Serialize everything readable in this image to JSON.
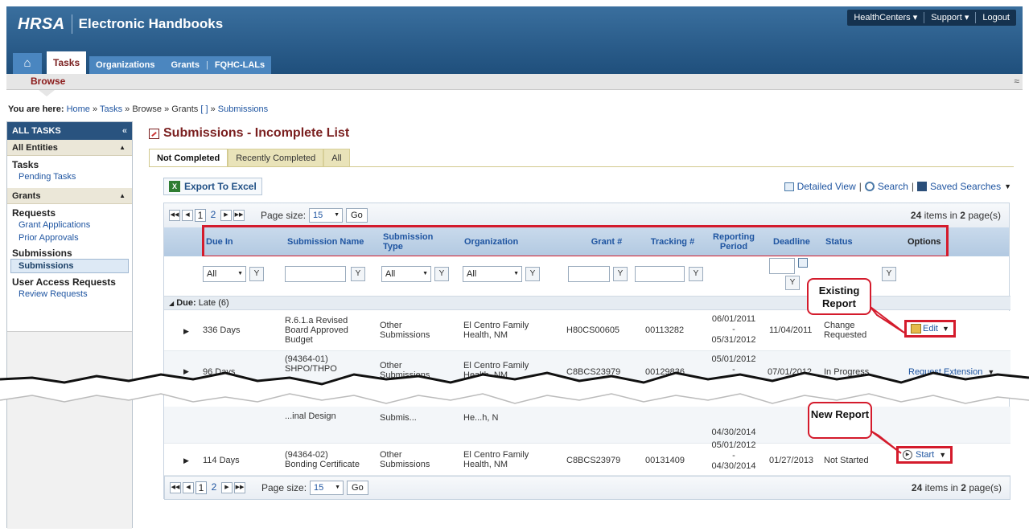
{
  "app": {
    "logo": "HRSA",
    "title": "Electronic Handbooks"
  },
  "top_links": [
    "HealthCenters ▾",
    "Support ▾",
    "Logout"
  ],
  "nav": {
    "home": "⌂",
    "tabs": [
      "Tasks",
      "Organizations",
      "Grants",
      "FQHC-LALs"
    ],
    "sep": "|"
  },
  "subnav": {
    "item": "Browse",
    "collapse": "≈"
  },
  "breadcrumb": {
    "prefix": "You are here:",
    "home": "Home",
    "tasks": "Tasks",
    "browse": "Browse",
    "grants": "Grants",
    "grants_suffix": "[  ]",
    "submissions": "Submissions",
    "sep": "»"
  },
  "sidebar": {
    "header": "ALL TASKS",
    "collapse": "«",
    "groups": [
      {
        "label": "All Entities",
        "sections": [
          {
            "title": "Tasks",
            "links": [
              "Pending Tasks"
            ]
          }
        ]
      },
      {
        "label": "Grants",
        "sections": [
          {
            "title": "Requests",
            "links": [
              "Grant Applications",
              "Prior Approvals"
            ]
          },
          {
            "title": "Submissions",
            "links": [
              "Submissions"
            ]
          },
          {
            "title": "User Access Requests",
            "links": [
              "Review Requests"
            ]
          }
        ]
      }
    ]
  },
  "page": {
    "title": "Submissions - Incomplete List"
  },
  "tabs": [
    "Not Completed",
    "Recently Completed",
    "All"
  ],
  "toolbar": {
    "export": "Export To Excel",
    "detailed_view": "Detailed View",
    "search": "Search",
    "saved_searches": "Saved Searches",
    "sep": "|"
  },
  "pager": {
    "pages": [
      "1",
      "2"
    ],
    "page_size_label": "Page size:",
    "page_size": "15",
    "go": "Go",
    "total": "24",
    "info_mid": "items in",
    "pages_count": "2",
    "info_end": "page(s)"
  },
  "columns": [
    "Due In",
    "Submission Name",
    "Submission Type",
    "Organization",
    "Grant #",
    "Tracking #",
    "Reporting Period",
    "Deadline",
    "Status",
    "Options"
  ],
  "filters": {
    "all": "All",
    "filter_icon": "Y"
  },
  "group": {
    "label": "Due:",
    "value": "Late (6)"
  },
  "rows": [
    {
      "due_in": "336 Days",
      "name": "R.6.1.a Revised Board Approved Budget",
      "type": "Other Submissions",
      "org": "El Centro Family Health, NM",
      "grant": "H80CS00605",
      "tracking": "00113282",
      "period_start": "06/01/2011",
      "period_dash": "-",
      "period_end": "05/31/2012",
      "deadline": "11/04/2011",
      "status": "Change Requested",
      "option": "Edit"
    },
    {
      "due_in": "96 Days",
      "name": "(94364-01) SHPO/THPO",
      "type": "Other Submissions",
      "org": "El Centro Family Health, NM",
      "grant": "C8BCS23979",
      "tracking": "00129836",
      "period_start": "05/01/2012",
      "period_dash": "-",
      "period_end": "",
      "deadline": "07/01/2012",
      "status": "In Progress",
      "option": "Request Extension"
    },
    {
      "due_in": "",
      "name": "...inal Design",
      "type": "Submis...",
      "org": "He...h, N",
      "grant": "",
      "tracking": "",
      "period_start": "",
      "period_dash": "",
      "period_end": "04/30/2014",
      "deadline": "",
      "status": "",
      "option": ""
    },
    {
      "due_in": "114 Days",
      "name": "(94364-02) Bonding Certificate",
      "type": "Other Submissions",
      "org": "El Centro Family Health, NM",
      "grant": "C8BCS23979",
      "tracking": "00131409",
      "period_start": "05/01/2012",
      "period_dash": "-",
      "period_end": "04/30/2014",
      "deadline": "01/27/2013",
      "status": "Not Started",
      "option": "Start"
    }
  ],
  "callouts": {
    "existing": "Existing Report",
    "new": "New Report"
  },
  "colors": {
    "header_blue": "#1f4f7c",
    "accent_red": "#d41b2c",
    "title_maroon": "#7a1f1f",
    "link_blue": "#1f55a1"
  }
}
